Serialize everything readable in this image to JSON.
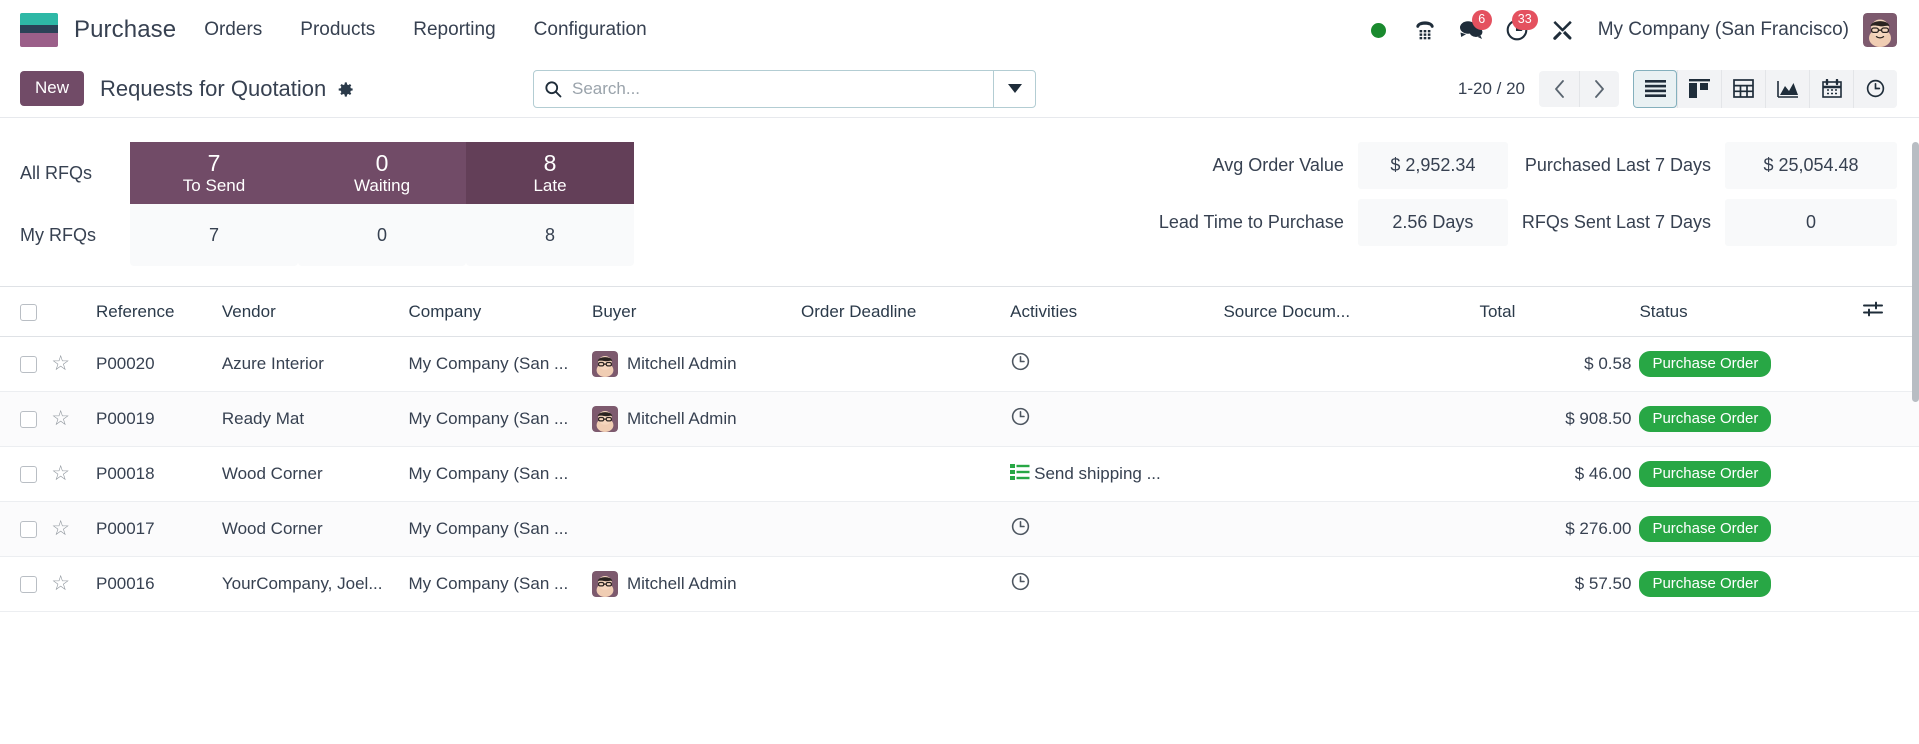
{
  "navbar": {
    "brand": "Purchase",
    "menu": [
      "Orders",
      "Products",
      "Reporting",
      "Configuration"
    ],
    "icons": {
      "status": "presence-online-dot",
      "phone": "phone-dialpad-icon",
      "messages": "messages-icon",
      "activities": "activities-clock-icon",
      "tools": "tools-icon"
    },
    "messages_count": "6",
    "activities_count": "33",
    "company": "My Company (San Francisco)",
    "avatar": "user-avatar"
  },
  "control_panel": {
    "new_button": "New",
    "breadcrumb": "Requests for Quotation",
    "gear": "gear-icon",
    "search_placeholder": "Search...",
    "search_value": "",
    "pager": "1-20 / 20",
    "views": [
      {
        "name": "list",
        "label": "List",
        "active": true
      },
      {
        "name": "kanban",
        "label": "Kanban",
        "active": false
      },
      {
        "name": "pivot",
        "label": "Pivot",
        "active": false
      },
      {
        "name": "graph",
        "label": "Graph",
        "active": false
      },
      {
        "name": "calendar",
        "label": "Calendar",
        "active": false
      },
      {
        "name": "activity",
        "label": "Activity",
        "active": false
      }
    ]
  },
  "dashboard": {
    "row_labels": [
      "All RFQs",
      "My RFQs"
    ],
    "columns": [
      {
        "label": "To Send",
        "all": "7",
        "mine": "7",
        "highlight": false
      },
      {
        "label": "Waiting",
        "all": "0",
        "mine": "0",
        "highlight": false
      },
      {
        "label": "Late",
        "all": "8",
        "mine": "8",
        "highlight": true
      }
    ],
    "kpis": [
      {
        "label": "Avg Order Value",
        "value": "$ 2,952.34"
      },
      {
        "label": "Purchased Last 7 Days",
        "value": "$ 25,054.48"
      },
      {
        "label": "Lead Time to Purchase",
        "value": "2.56 Days"
      },
      {
        "label": "RFQs Sent Last 7 Days",
        "value": "0"
      }
    ]
  },
  "table": {
    "headers": {
      "reference": "Reference",
      "vendor": "Vendor",
      "company": "Company",
      "buyer": "Buyer",
      "deadline": "Order Deadline",
      "activities": "Activities",
      "source": "Source Docum...",
      "total": "Total",
      "status": "Status"
    },
    "optional_columns_icon": "sliders-icon",
    "rows": [
      {
        "reference": "P00020",
        "vendor": "Azure Interior",
        "company": "My Company (San ...",
        "buyer": "Mitchell Admin",
        "has_avatar": true,
        "deadline": "",
        "activity_icon": "clock-icon",
        "activity_text": "",
        "source": "",
        "total": "$ 0.58",
        "status": "Purchase Order"
      },
      {
        "reference": "P00019",
        "vendor": "Ready Mat",
        "company": "My Company (San ...",
        "buyer": "Mitchell Admin",
        "has_avatar": true,
        "deadline": "",
        "activity_icon": "clock-icon",
        "activity_text": "",
        "source": "",
        "total": "$ 908.50",
        "status": "Purchase Order"
      },
      {
        "reference": "P00018",
        "vendor": "Wood Corner",
        "company": "My Company (San ...",
        "buyer": "",
        "has_avatar": false,
        "deadline": "",
        "activity_icon": "tasks-icon",
        "activity_text": "Send shipping ...",
        "source": "",
        "total": "$ 46.00",
        "status": "Purchase Order"
      },
      {
        "reference": "P00017",
        "vendor": "Wood Corner",
        "company": "My Company (San ...",
        "buyer": "",
        "has_avatar": false,
        "deadline": "",
        "activity_icon": "clock-icon",
        "activity_text": "",
        "source": "",
        "total": "$ 276.00",
        "status": "Purchase Order"
      },
      {
        "reference": "P00016",
        "vendor": "YourCompany, Joel...",
        "company": "My Company (San ...",
        "buyer": "Mitchell Admin",
        "has_avatar": true,
        "deadline": "",
        "activity_icon": "clock-icon",
        "activity_text": "",
        "source": "",
        "total": "$ 57.50",
        "status": "Purchase Order"
      }
    ]
  },
  "colors": {
    "brand_purple": "#714b67",
    "status_green": "#28a745",
    "badge_red": "#e4515f",
    "presence_green": "#1a8a2e"
  }
}
